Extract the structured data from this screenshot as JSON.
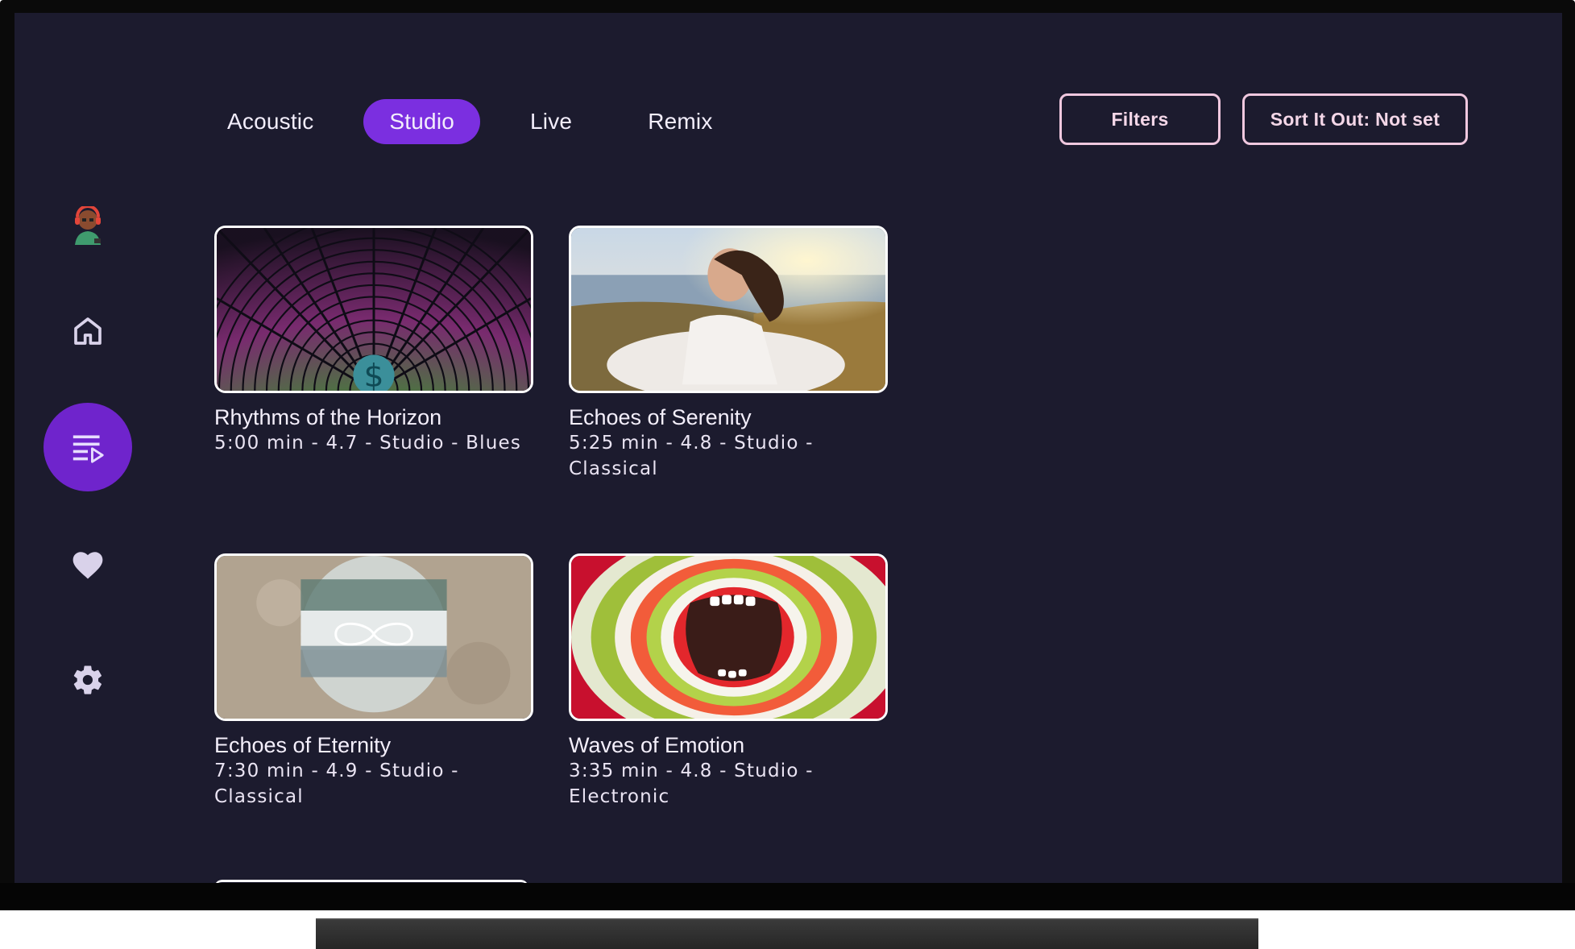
{
  "tabs": [
    {
      "label": "Acoustic",
      "active": false
    },
    {
      "label": "Studio",
      "active": true
    },
    {
      "label": "Live",
      "active": false
    },
    {
      "label": "Remix",
      "active": false
    }
  ],
  "toolbar": {
    "filters_label": "Filters",
    "sort_label": "Sort It Out: Not set"
  },
  "sidebar": {
    "items": [
      {
        "icon": "avatar-icon"
      },
      {
        "icon": "home-icon"
      },
      {
        "icon": "playlist-play-icon",
        "active": true
      },
      {
        "icon": "heart-icon"
      },
      {
        "icon": "gear-icon"
      }
    ]
  },
  "cards": [
    {
      "title": "Rhythms of the Horizon",
      "meta": "5:00 min  - 4.7 - Studio - Blues"
    },
    {
      "title": "Echoes of Serenity",
      "meta": "5:25 min  - 4.8 - Studio - Classical"
    },
    {
      "title": "Echoes of Eternity",
      "meta": "7:30 min  - 4.9 - Studio - Classical"
    },
    {
      "title": "Waves of Emotion",
      "meta": "3:35 min  - 4.8 - Studio - Electronic"
    }
  ],
  "colors": {
    "background": "#1c1b2e",
    "accent": "#7b2fe0",
    "button_border": "#f0c8df"
  }
}
